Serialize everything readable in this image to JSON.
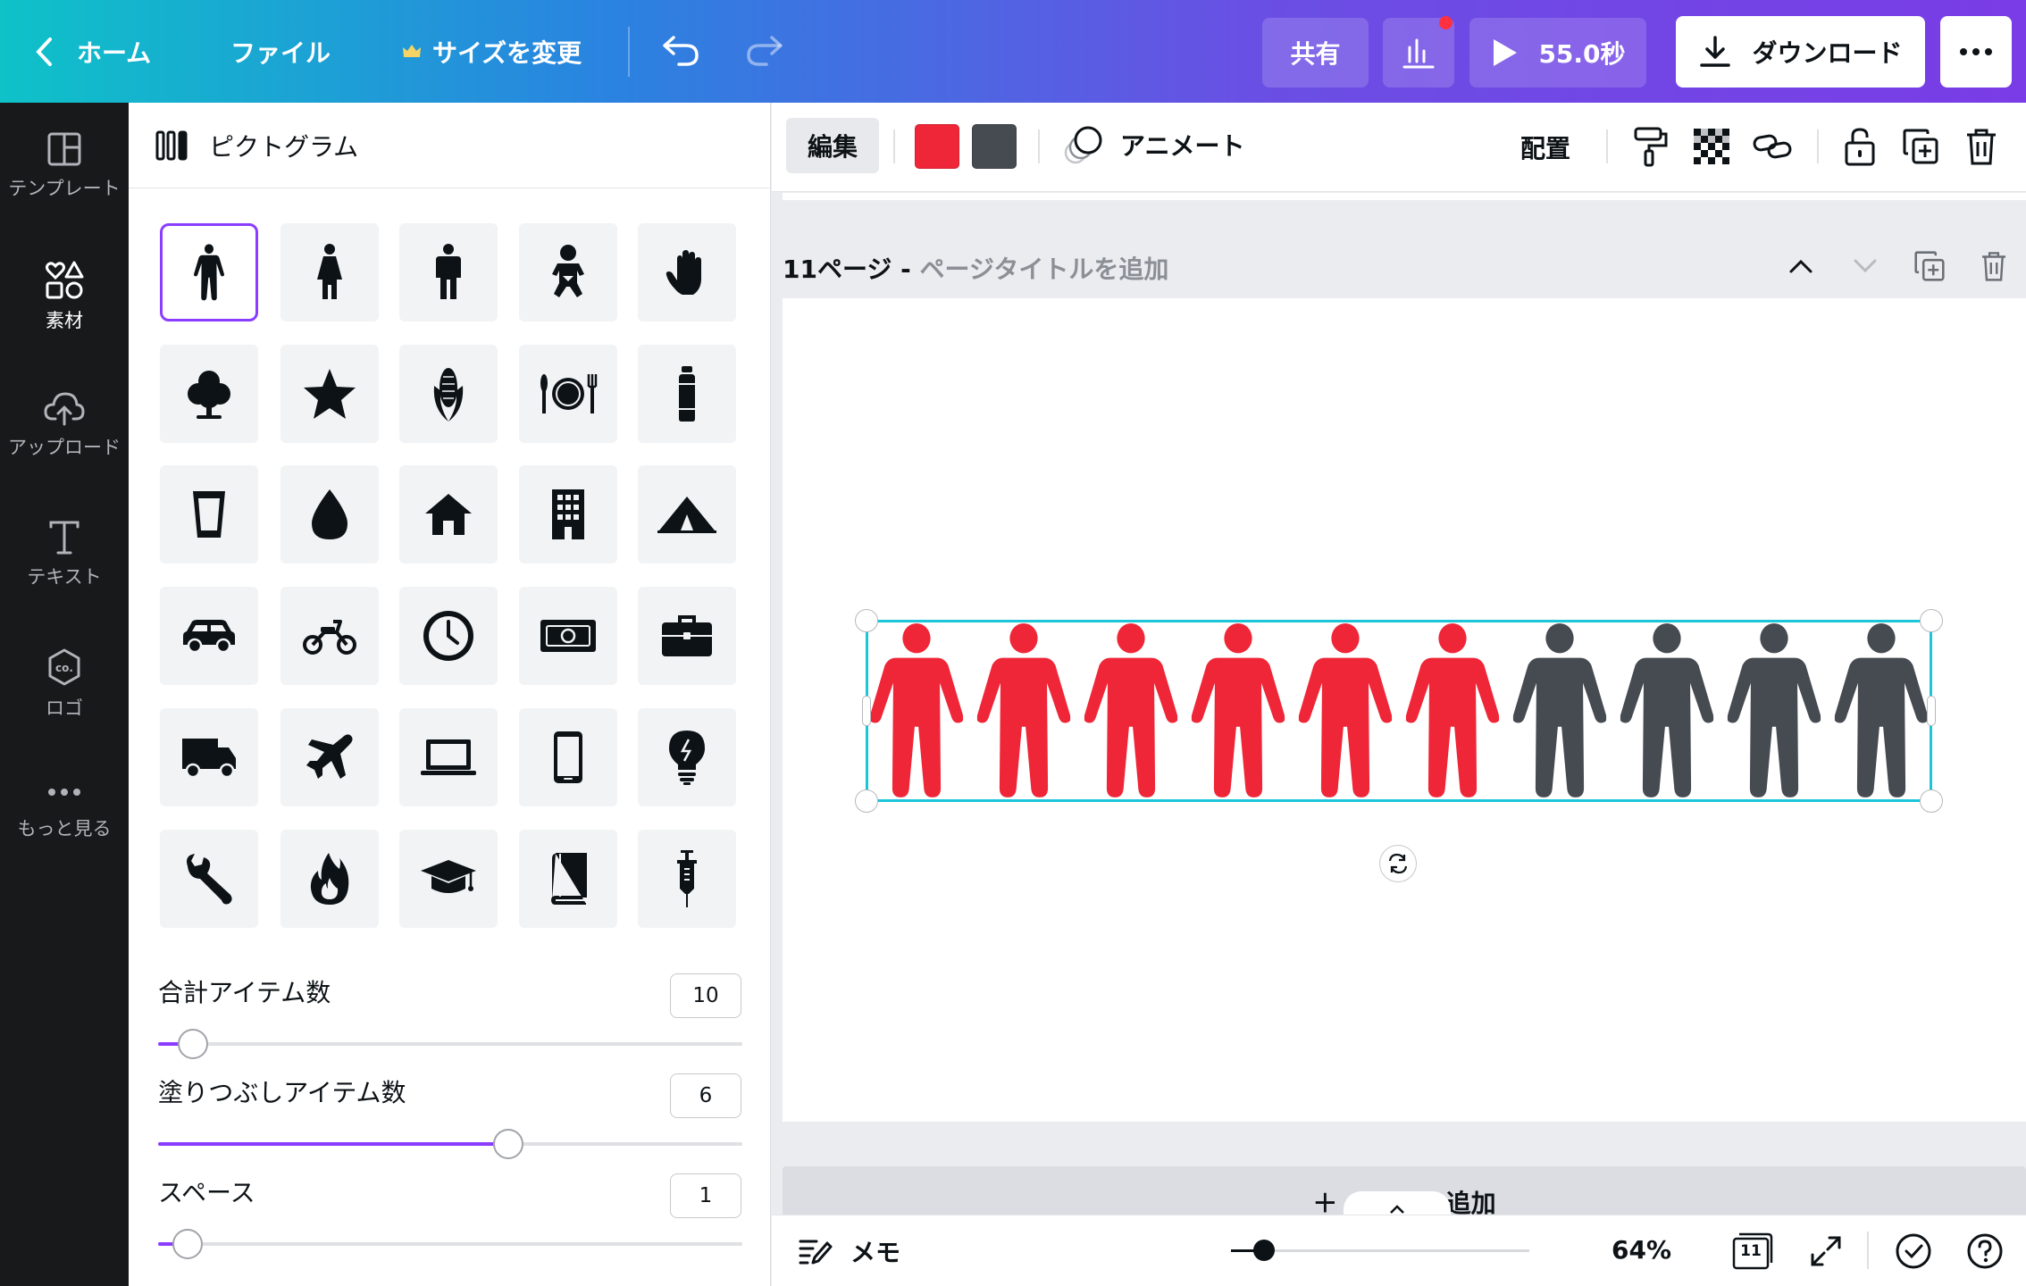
{
  "topbar": {
    "home_label": "ホーム",
    "file_label": "ファイル",
    "resize_label": "サイズを変更",
    "share_label": "共有",
    "play_duration": "55.0秒",
    "download_label": "ダウンロード"
  },
  "rail": {
    "items": [
      {
        "label": "テンプレート"
      },
      {
        "label": "素材"
      },
      {
        "label": "アップロード"
      },
      {
        "label": "テキスト"
      },
      {
        "label": "ロゴ"
      },
      {
        "label": "もっと見る"
      }
    ]
  },
  "panel": {
    "title": "ピクトグラム",
    "icons": [
      "person",
      "woman",
      "man",
      "baby",
      "hand",
      "tree",
      "star",
      "corn",
      "plate",
      "bottle",
      "cup",
      "drop",
      "house",
      "building",
      "tent",
      "car",
      "scooter",
      "clock",
      "money",
      "briefcase",
      "truck",
      "airplane",
      "laptop",
      "phone",
      "bulb",
      "wrench",
      "fire",
      "graduation-cap",
      "book",
      "syringe"
    ],
    "controls": {
      "total_label": "合計アイテム数",
      "total_value": "10",
      "total_fraction": 0.06,
      "filled_label": "塗りつぶしアイテム数",
      "filled_value": "6",
      "filled_fraction": 0.6,
      "space_label": "スペース",
      "space_value": "1",
      "space_fraction": 0.05
    }
  },
  "contextbar": {
    "edit_label": "編集",
    "color_primary": "#ef2637",
    "color_secondary": "#464a51",
    "animate_label": "アニメート",
    "arrange_label": "配置"
  },
  "page": {
    "title_prefix": "11ページ - ",
    "title_placeholder": "ページタイトルを追加",
    "pictogram_total": 10,
    "pictogram_filled": 6,
    "add_page_label": "＋ ページを追加"
  },
  "bottombar": {
    "notes_label": "メモ",
    "zoom_label": "64%",
    "page_count": "11",
    "zoom_fraction": 0.11
  },
  "colors": {
    "accent": "#8b3dff",
    "selection": "#1ac6d8"
  }
}
